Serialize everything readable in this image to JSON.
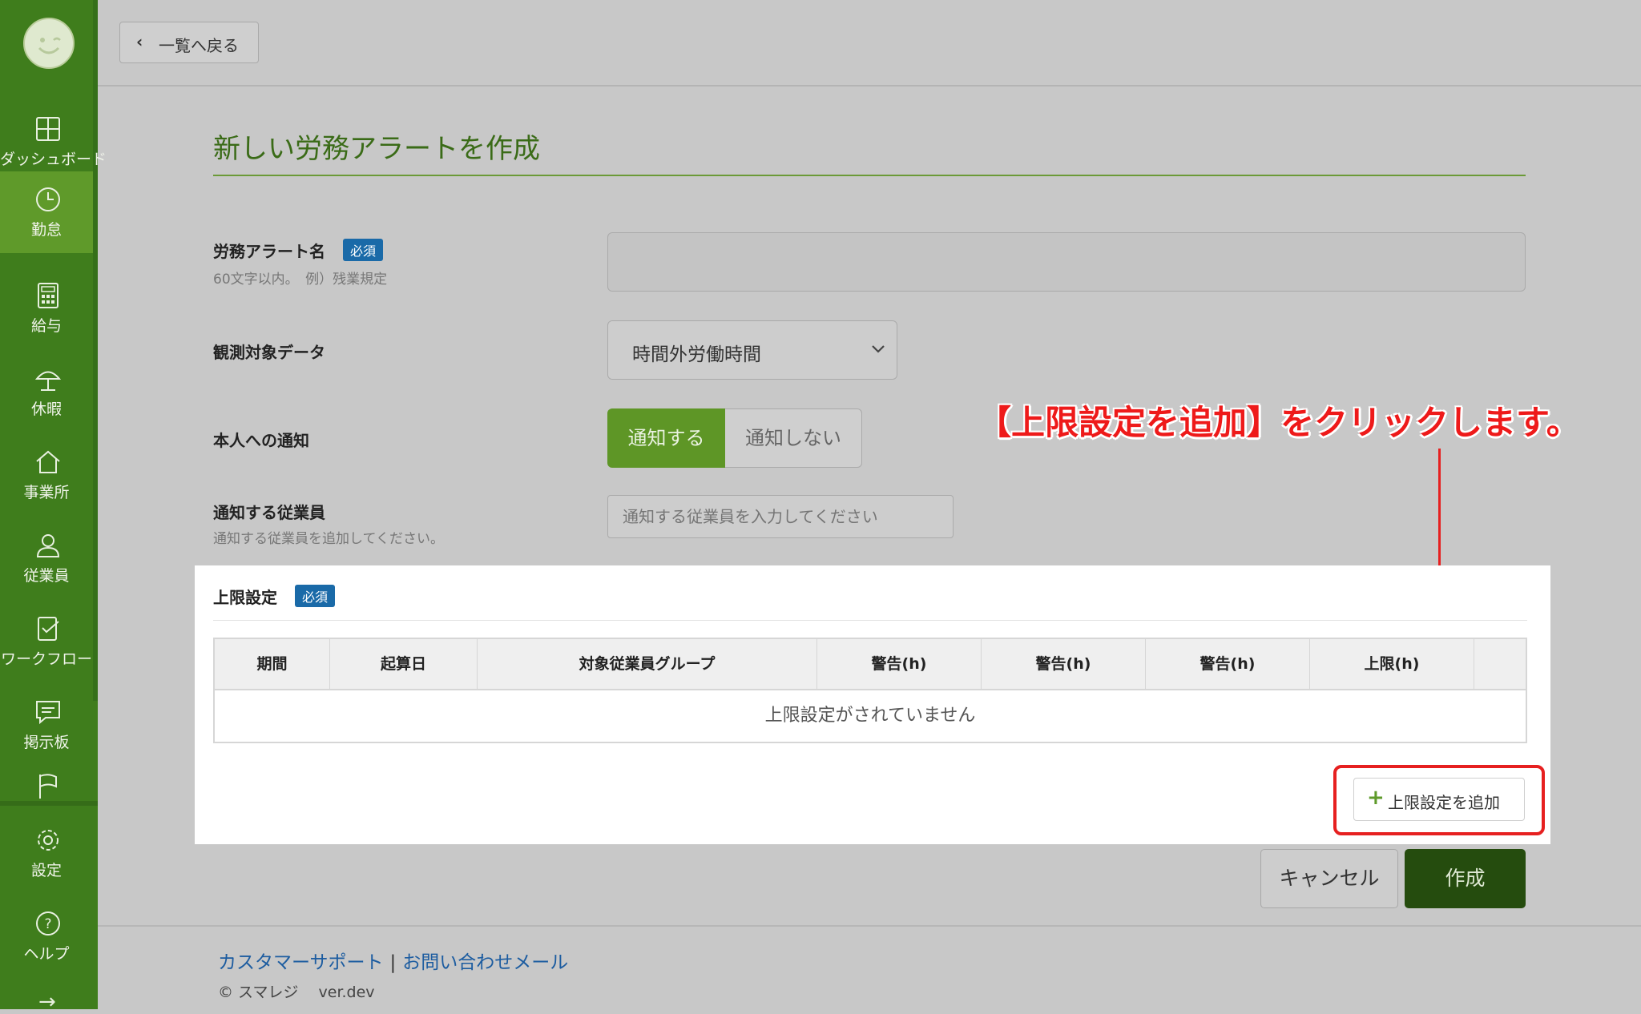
{
  "sidebar": {
    "items": [
      {
        "label": "ダッシュボード",
        "icon": "dashboard-icon"
      },
      {
        "label": "勤怠",
        "icon": "clock-icon",
        "active": true
      },
      {
        "label": "給与",
        "icon": "calculator-icon"
      },
      {
        "label": "休暇",
        "icon": "umbrella-icon"
      },
      {
        "label": "事業所",
        "icon": "home-icon"
      },
      {
        "label": "従業員",
        "icon": "person-icon"
      },
      {
        "label": "ワークフロー",
        "icon": "checklist-icon"
      },
      {
        "label": "掲示板",
        "icon": "chat-icon"
      },
      {
        "label": "",
        "icon": "flag-icon"
      },
      {
        "label": "設定",
        "icon": "gear-icon"
      },
      {
        "label": "ヘルプ",
        "icon": "help-icon"
      }
    ],
    "collapse_arrow": "→"
  },
  "topbar": {
    "back_label": "一覧へ戻る"
  },
  "page": {
    "title": "新しい労務アラートを作成"
  },
  "form": {
    "name_label": "労務アラート名",
    "required_badge": "必須",
    "name_help": "60文字以内。　例）残業規定",
    "name_value": "",
    "data_label": "観測対象データ",
    "data_value": "時間外労働時間",
    "notify_label": "本人への通知",
    "notify_on": "通知する",
    "notify_off": "通知しない",
    "notify_selected": "通知する",
    "emp_label": "通知する従業員",
    "emp_help": "通知する従業員を追加してください。",
    "emp_placeholder": "通知する従業員を入力してください"
  },
  "limit": {
    "title": "上限設定",
    "required_badge": "必須",
    "columns": [
      "期間",
      "起算日",
      "対象従業員グループ",
      "警告(h)",
      "警告(h)",
      "警告(h)",
      "上限(h)",
      ""
    ],
    "empty_text": "上限設定がされていません",
    "add_label": "上限設定を追加"
  },
  "annotation": {
    "text": "【上限設定を追加】をクリックします。",
    "color": "#ee1a1a"
  },
  "actions": {
    "cancel": "キャンセル",
    "create": "作成"
  },
  "footer": {
    "support": "カスタマーサポート",
    "separator": "|",
    "mail": "お問い合わせメール",
    "copyright": "© スマレジ　 ver.dev"
  },
  "colors": {
    "sidebar": "#3f7d1c",
    "accent": "#5e9626",
    "primary_button": "#254c0e",
    "badge": "#1a6aa8"
  }
}
